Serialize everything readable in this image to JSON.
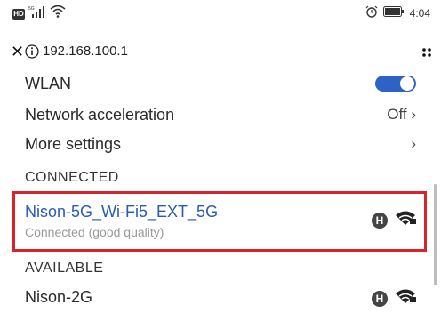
{
  "status_bar": {
    "hd_label": "HD",
    "network_small": "5G",
    "time": "4:04",
    "icons": [
      "hd-icon",
      "signal-icon",
      "wifi-icon",
      "alarm-icon",
      "battery-icon"
    ]
  },
  "url_bar": {
    "url": "192.168.100.1",
    "close_icon": "close-icon",
    "info_icon": "info-icon",
    "menu_icon": "menu-dots-icon"
  },
  "settings": {
    "wlan_label": "WLAN",
    "wlan_enabled": true,
    "network_acceleration_label": "Network acceleration",
    "network_acceleration_value": "Off",
    "more_settings_label": "More settings"
  },
  "connected": {
    "header": "CONNECTED",
    "network_name": "Nison-5G_Wi-Fi5_EXT_5G",
    "status": "Connected (good quality)",
    "badge": "H"
  },
  "available": {
    "header": "AVAILABLE",
    "networks": [
      {
        "name": "Nison-2G",
        "badge": "H"
      }
    ]
  },
  "colors": {
    "accent": "#2f62c5",
    "highlight": "#d9232a",
    "connected_name": "#2a5bb5"
  }
}
